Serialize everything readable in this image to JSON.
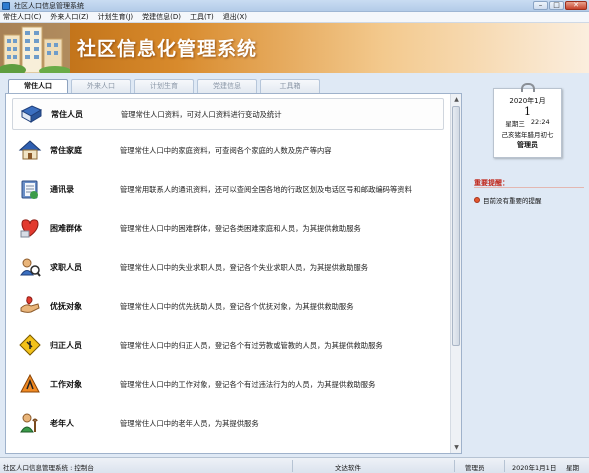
{
  "window": {
    "title": "社区人口信息管理系统",
    "buttons": {
      "minimize": "–",
      "maximize": "□",
      "close": "✕"
    }
  },
  "menu": [
    {
      "label": "常住人口(C)"
    },
    {
      "label": "外来人口(Z)"
    },
    {
      "label": "计划生育(J)"
    },
    {
      "label": "党建信息(D)"
    },
    {
      "label": "工具(T)"
    },
    {
      "label": "退出(X)"
    }
  ],
  "banner": {
    "title": "社区信息化管理系统"
  },
  "tabs": [
    {
      "label": "常住人口",
      "active": true
    },
    {
      "label": "外来人口",
      "active": false
    },
    {
      "label": "计划生育",
      "active": false
    },
    {
      "label": "党建信息",
      "active": false
    },
    {
      "label": "工具箱",
      "active": false
    }
  ],
  "items": [
    {
      "name": "常住人员",
      "icon": "book-icon",
      "desc": "管理常住人口资料，可对人口资料进行变动及统计"
    },
    {
      "name": "常住家庭",
      "icon": "house-icon",
      "desc": "管理常住人口中的家庭资料，可查阅各个家庭的人数及房产等内容"
    },
    {
      "name": "通讯录",
      "icon": "address-book-icon",
      "desc": "管理常用联系人的通讯资料，还可以查阅全国各地的行政区划及电话区号和邮政编码等资料"
    },
    {
      "name": "困难群体",
      "icon": "heart-icon",
      "desc": "管理常住人口中的困难群体，登记各类困难家庭和人员，为其提供救助服务"
    },
    {
      "name": "求职人员",
      "icon": "job-seeker-icon",
      "desc": "管理常住人口中的失业求职人员，登记各个失业求职人员，为其提供救助服务"
    },
    {
      "name": "优抚对象",
      "icon": "preferential-care-icon",
      "desc": "管理常住人口中的优先抚助人员，登记各个优抚对象，为其提供救助服务"
    },
    {
      "name": "归正人员",
      "icon": "warning-sign-icon",
      "desc": "管理常住人口中的归正人员，登记各个有过劳教或管教的人员，为其提供救助服务"
    },
    {
      "name": "工作对象",
      "icon": "work-target-icon",
      "desc": "管理常住人口中的工作对象，登记各个有过违法行为的人员，为其提供救助服务"
    },
    {
      "name": "老年人",
      "icon": "elderly-icon",
      "desc": "管理常住人口中的老年人员，为其提供服务"
    }
  ],
  "calendar": {
    "year_month": "2020年1月",
    "day": "1",
    "weekday": "星期三",
    "time": "22:24",
    "lunar": "己亥猪年腊月初七",
    "user": "管理员"
  },
  "notices": {
    "title": "重要提醒：",
    "items": [
      "目前没有重要的提醒"
    ]
  },
  "status": {
    "app": "社区人口信息管理系统",
    "module": "控制台",
    "company": "文达软件",
    "user": "管理员",
    "date": "2020年1月1日",
    "weekday": "星期"
  },
  "colors": {
    "banner_start": "#b5660f",
    "banner_end": "#fbeede",
    "notice_title": "#c0271b"
  }
}
